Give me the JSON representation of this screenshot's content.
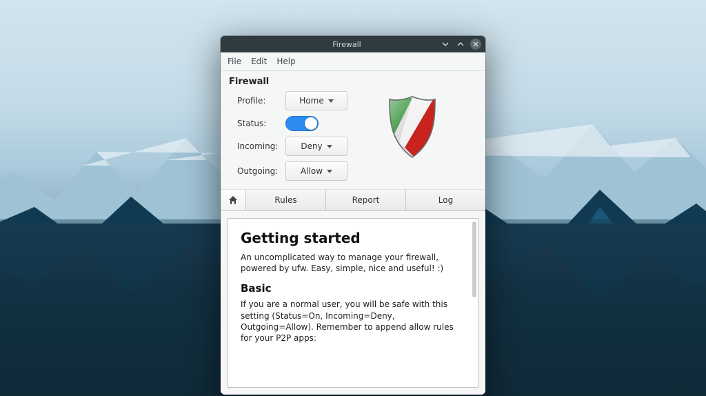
{
  "window": {
    "title": "Firewall"
  },
  "menubar": {
    "file": "File",
    "edit": "Edit",
    "help": "Help"
  },
  "header": {
    "title": "Firewall"
  },
  "settings": {
    "profile_label": "Profile:",
    "profile_value": "Home",
    "status_label": "Status:",
    "status_on": true,
    "incoming_label": "Incoming:",
    "incoming_value": "Deny",
    "outgoing_label": "Outgoing:",
    "outgoing_value": "Allow"
  },
  "tabs": {
    "home_icon": "home-icon",
    "rules": "Rules",
    "report": "Report",
    "log": "Log"
  },
  "content": {
    "h1": "Getting started",
    "intro": "An uncomplicated way to manage your firewall, powered by ufw. Easy, simple, nice and useful! :)",
    "h2": "Basic",
    "basic_text": "If you are a normal user, you will be safe with this setting (Status=On, Incoming=Deny, Outgoing=Allow). Remember to append allow rules for your P2P apps:"
  },
  "colors": {
    "accent": "#2d8cf0",
    "titlebar": "#2f3b3f",
    "shield_green": "#2d8e32",
    "shield_red": "#c8231f",
    "shield_white": "#f3f3f3"
  }
}
